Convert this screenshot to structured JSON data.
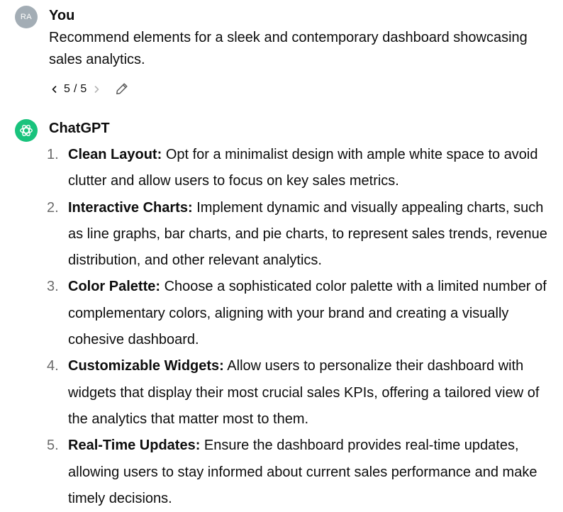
{
  "user_message": {
    "avatar_initials": "RA",
    "author": "You",
    "text": "Recommend elements for a sleek and contemporary dashboard showcasing sales analytics.",
    "pager": {
      "current": "5 / 5"
    }
  },
  "assistant_message": {
    "author": "ChatGPT",
    "items": [
      {
        "number": "1.",
        "heading": "Clean Layout:",
        "text": "Opt for a minimalist design with ample white space to avoid clutter and allow users to focus on key sales metrics."
      },
      {
        "number": "2.",
        "heading": "Interactive Charts:",
        "text": "Implement dynamic and visually appealing charts, such as line graphs, bar charts, and pie charts, to represent sales trends, revenue distribution, and other relevant analytics."
      },
      {
        "number": "3.",
        "heading": "Color Palette:",
        "text": "Choose a sophisticated color palette with a limited number of complementary colors, aligning with your brand and creating a visually cohesive dashboard."
      },
      {
        "number": "4.",
        "heading": "Customizable Widgets:",
        "text": "Allow users to personalize their dashboard with widgets that display their most crucial sales KPIs, offering a tailored view of the analytics that matter most to them."
      },
      {
        "number": "5.",
        "heading": "Real-Time Updates:",
        "text": "Ensure the dashboard provides real-time updates, allowing users to stay informed about current sales performance and make timely decisions."
      }
    ]
  },
  "colors": {
    "assistant_avatar": "#19c37d",
    "user_avatar": "#a3adb5",
    "list_number": "#6b6b6b"
  },
  "icons": {
    "prev": "chevron-left-icon",
    "next": "chevron-right-icon",
    "edit": "pencil-icon",
    "assistant_logo": "openai-logo-icon"
  }
}
